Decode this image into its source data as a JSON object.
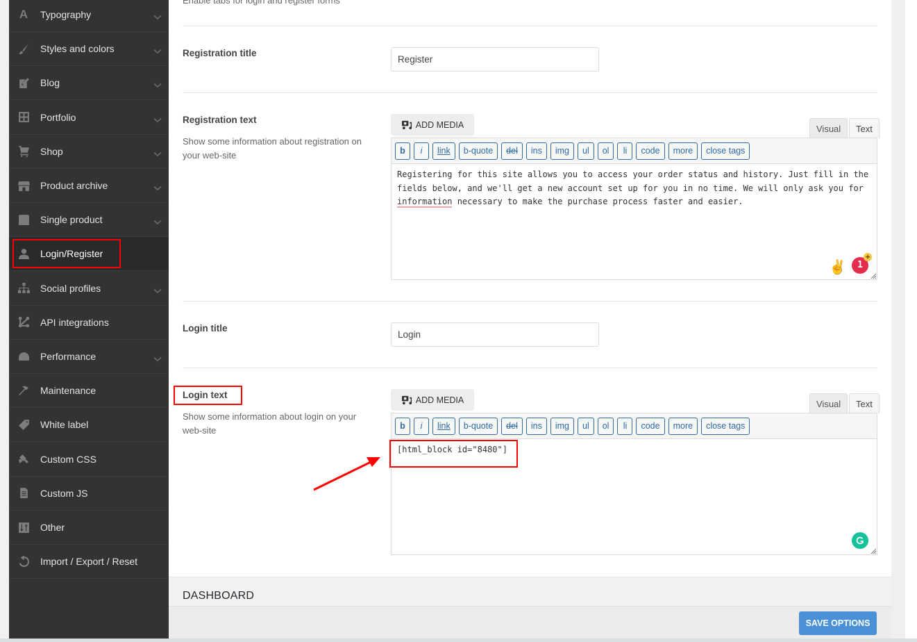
{
  "sidebar": {
    "items": [
      {
        "label": "Typography",
        "icon": "typography-icon",
        "chevron": true
      },
      {
        "label": "Styles and colors",
        "icon": "brush-icon",
        "chevron": true
      },
      {
        "label": "Blog",
        "icon": "edit-icon",
        "chevron": true
      },
      {
        "label": "Portfolio",
        "icon": "grid-icon",
        "chevron": true
      },
      {
        "label": "Shop",
        "icon": "cart-icon",
        "chevron": true
      },
      {
        "label": "Product archive",
        "icon": "store-icon",
        "chevron": true
      },
      {
        "label": "Single product",
        "icon": "bag-icon",
        "chevron": true
      },
      {
        "label": "Login/Register",
        "icon": "user-icon",
        "chevron": false,
        "active": true
      },
      {
        "label": "Social profiles",
        "icon": "sitemap-icon",
        "chevron": true
      },
      {
        "label": "API integrations",
        "icon": "api-icon",
        "chevron": false
      },
      {
        "label": "Performance",
        "icon": "gauge-icon",
        "chevron": true
      },
      {
        "label": "Maintenance",
        "icon": "hammer-icon",
        "chevron": false
      },
      {
        "label": "White label",
        "icon": "tag-icon",
        "chevron": false
      },
      {
        "label": "Custom CSS",
        "icon": "paint-icon",
        "chevron": false
      },
      {
        "label": "Custom JS",
        "icon": "document-icon",
        "chevron": false
      },
      {
        "label": "Other",
        "icon": "sort-icon",
        "chevron": false
      },
      {
        "label": "Import / Export / Reset",
        "icon": "reset-icon",
        "chevron": false
      }
    ]
  },
  "main": {
    "top_desc": "Enable tabs for login and register forms",
    "registration_title": {
      "label": "Registration title",
      "value": "Register"
    },
    "registration_text": {
      "label": "Registration text",
      "desc": "Show some information about registration on your web-site",
      "add_media": "ADD MEDIA",
      "tab_visual": "Visual",
      "tab_text": "Text",
      "content_before": "Registering for this site allows you to access your order status and history. Just fill in the fields below, and we'll get a new account set up for you in no time. We will only ask you for ",
      "content_misspelled": "information",
      "content_after": " necessary to make the purchase process faster and easier.",
      "emoji": "✌️",
      "notification_count": "1",
      "notification_plus": "+"
    },
    "login_title": {
      "label": "Login title",
      "value": "Login"
    },
    "login_text": {
      "label": "Login text",
      "desc": "Show some information about login on your web-site",
      "add_media": "ADD MEDIA",
      "tab_visual": "Visual",
      "tab_text": "Text",
      "content": "[html_block id=\"8480\"]"
    },
    "quicktags": [
      "b",
      "i",
      "link",
      "b-quote",
      "del",
      "ins",
      "img",
      "ul",
      "ol",
      "li",
      "code",
      "more",
      "close tags"
    ]
  },
  "dashboard": {
    "title": "DASHBOARD"
  },
  "footer": {
    "save_label": "SAVE OPTIONS"
  },
  "colors": {
    "sidebar_bg": "#333333",
    "highlight": "#ff0000",
    "save_button": "#4a90d6",
    "quicktag_blue": "#2e6ba3",
    "grammarly": "#15c39a"
  }
}
